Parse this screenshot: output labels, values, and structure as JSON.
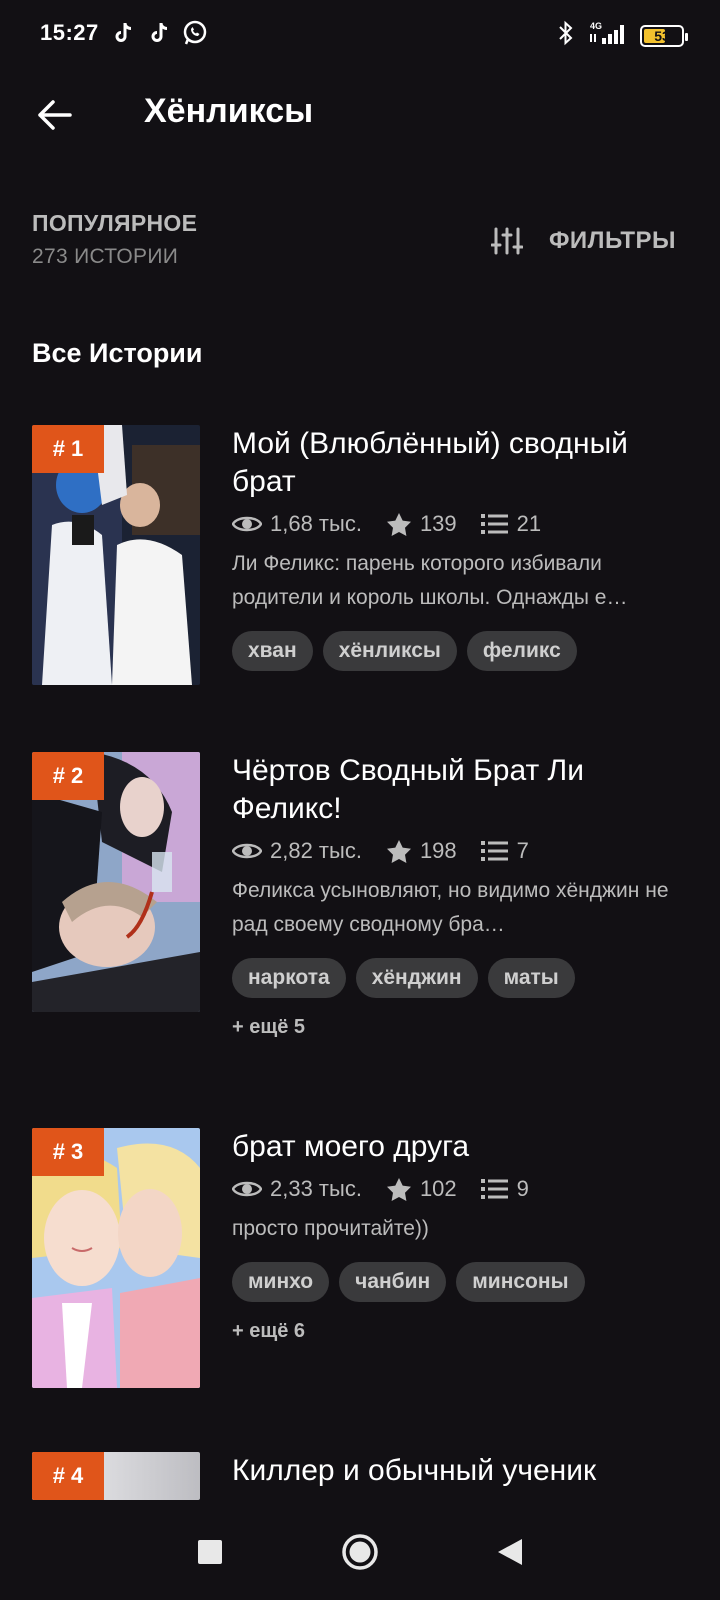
{
  "status_bar": {
    "time": "15:27",
    "battery": "53",
    "network": "4G"
  },
  "header": {
    "title": "Хёнликсы"
  },
  "sort": {
    "label": "ПОПУЛЯРНОЕ",
    "count": "273 ИСТОРИИ"
  },
  "filters": {
    "label": "ФИЛЬТРЫ"
  },
  "section": {
    "title": "Все Истории"
  },
  "stories": [
    {
      "rank": "# 1",
      "title": "Мой (Влюблённый) сводный брат",
      "views": "1,68 тыс.",
      "votes": "139",
      "parts": "21",
      "description": "Ли Феликс: парень которого избивали родители и король школы. Однажды е…",
      "tags": [
        "хван",
        "хёнликсы",
        "феликс"
      ],
      "more": ""
    },
    {
      "rank": "# 2",
      "title": "Чёртов Сводный Брат Ли Феликс!",
      "views": "2,82 тыс.",
      "votes": "198",
      "parts": "7",
      "description": "Феликса усыновляют, но видимо хёнджин не рад своему сводному бра…",
      "tags": [
        "наркота",
        "хёнджин",
        "маты"
      ],
      "more": "+ ещё 5"
    },
    {
      "rank": "# 3",
      "title": "брат моего друга",
      "views": "2,33 тыс.",
      "votes": "102",
      "parts": "9",
      "description": "просто прочитайте))",
      "tags": [
        "минхо",
        "чанбин",
        "минсоны"
      ],
      "more": "+ ещё 6"
    },
    {
      "rank": "# 4",
      "title": "Киллер и обычный ученик"
    }
  ],
  "icons": {
    "back": "arrow-left-icon",
    "filters": "sliders-icon",
    "views": "eye-icon",
    "votes": "star-icon",
    "parts": "list-icon"
  },
  "colors": {
    "background": "#121014",
    "accent": "#e0551a",
    "tag_bg": "#3a3a3c",
    "muted_text": "#bcbcbc"
  }
}
